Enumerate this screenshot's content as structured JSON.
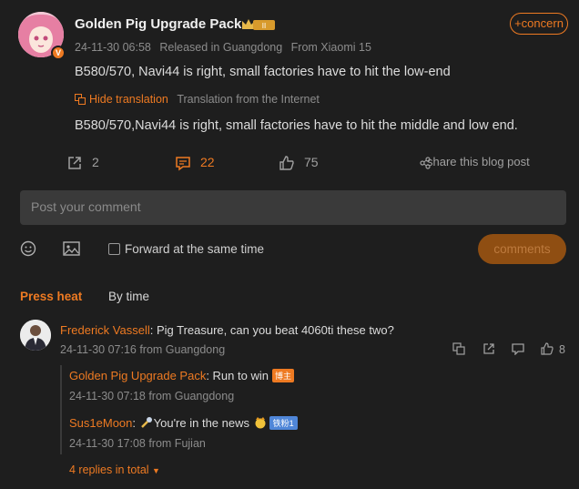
{
  "post": {
    "username": "Golden Pig Upgrade Pack",
    "level_badge": "II",
    "avatar_badge": "V",
    "timestamp": "24-11-30 06:58",
    "location": "Released in Guangdong",
    "device": "From Xiaomi 15",
    "follow_label": "+concern",
    "text": "B580/570, Navi44 is right, small factories have to hit the low-end",
    "hide_translation_label": "Hide translation",
    "translation_source": "Translation from the Internet",
    "original_text": "B580/570,Navi44 is right, small factories have to hit the middle and low end.",
    "share_count": "2",
    "comment_count": "22",
    "like_count": "75",
    "share_blog_label": "share this blog post"
  },
  "composer": {
    "placeholder": "Post your comment",
    "forward_label": "Forward at the same time",
    "submit_label": "comments"
  },
  "sort": {
    "press_heat": "Press heat",
    "by_time": "By time"
  },
  "comment": {
    "author": "Frederick Vassell",
    "text": ": Pig Treasure, can you beat 4060ti these two?",
    "meta": "24-11-30 07:16 from Guangdong",
    "likes": "8",
    "replies": [
      {
        "author": "Golden Pig Upgrade Pack",
        "text": ": Run to win",
        "tag": "博主",
        "meta": "24-11-30 07:18 from Guangdong"
      },
      {
        "author": "Sus1eMoon",
        "text": "You're in the news",
        "tag": "铁粉1",
        "meta": "24-11-30 17:08 from Fujian"
      }
    ],
    "more_replies": "4 replies in total"
  },
  "colors": {
    "accent": "#ee7a22",
    "background": "#1e1e1e",
    "input_bg": "#3a3a3a",
    "muted": "#8c8c8c"
  }
}
